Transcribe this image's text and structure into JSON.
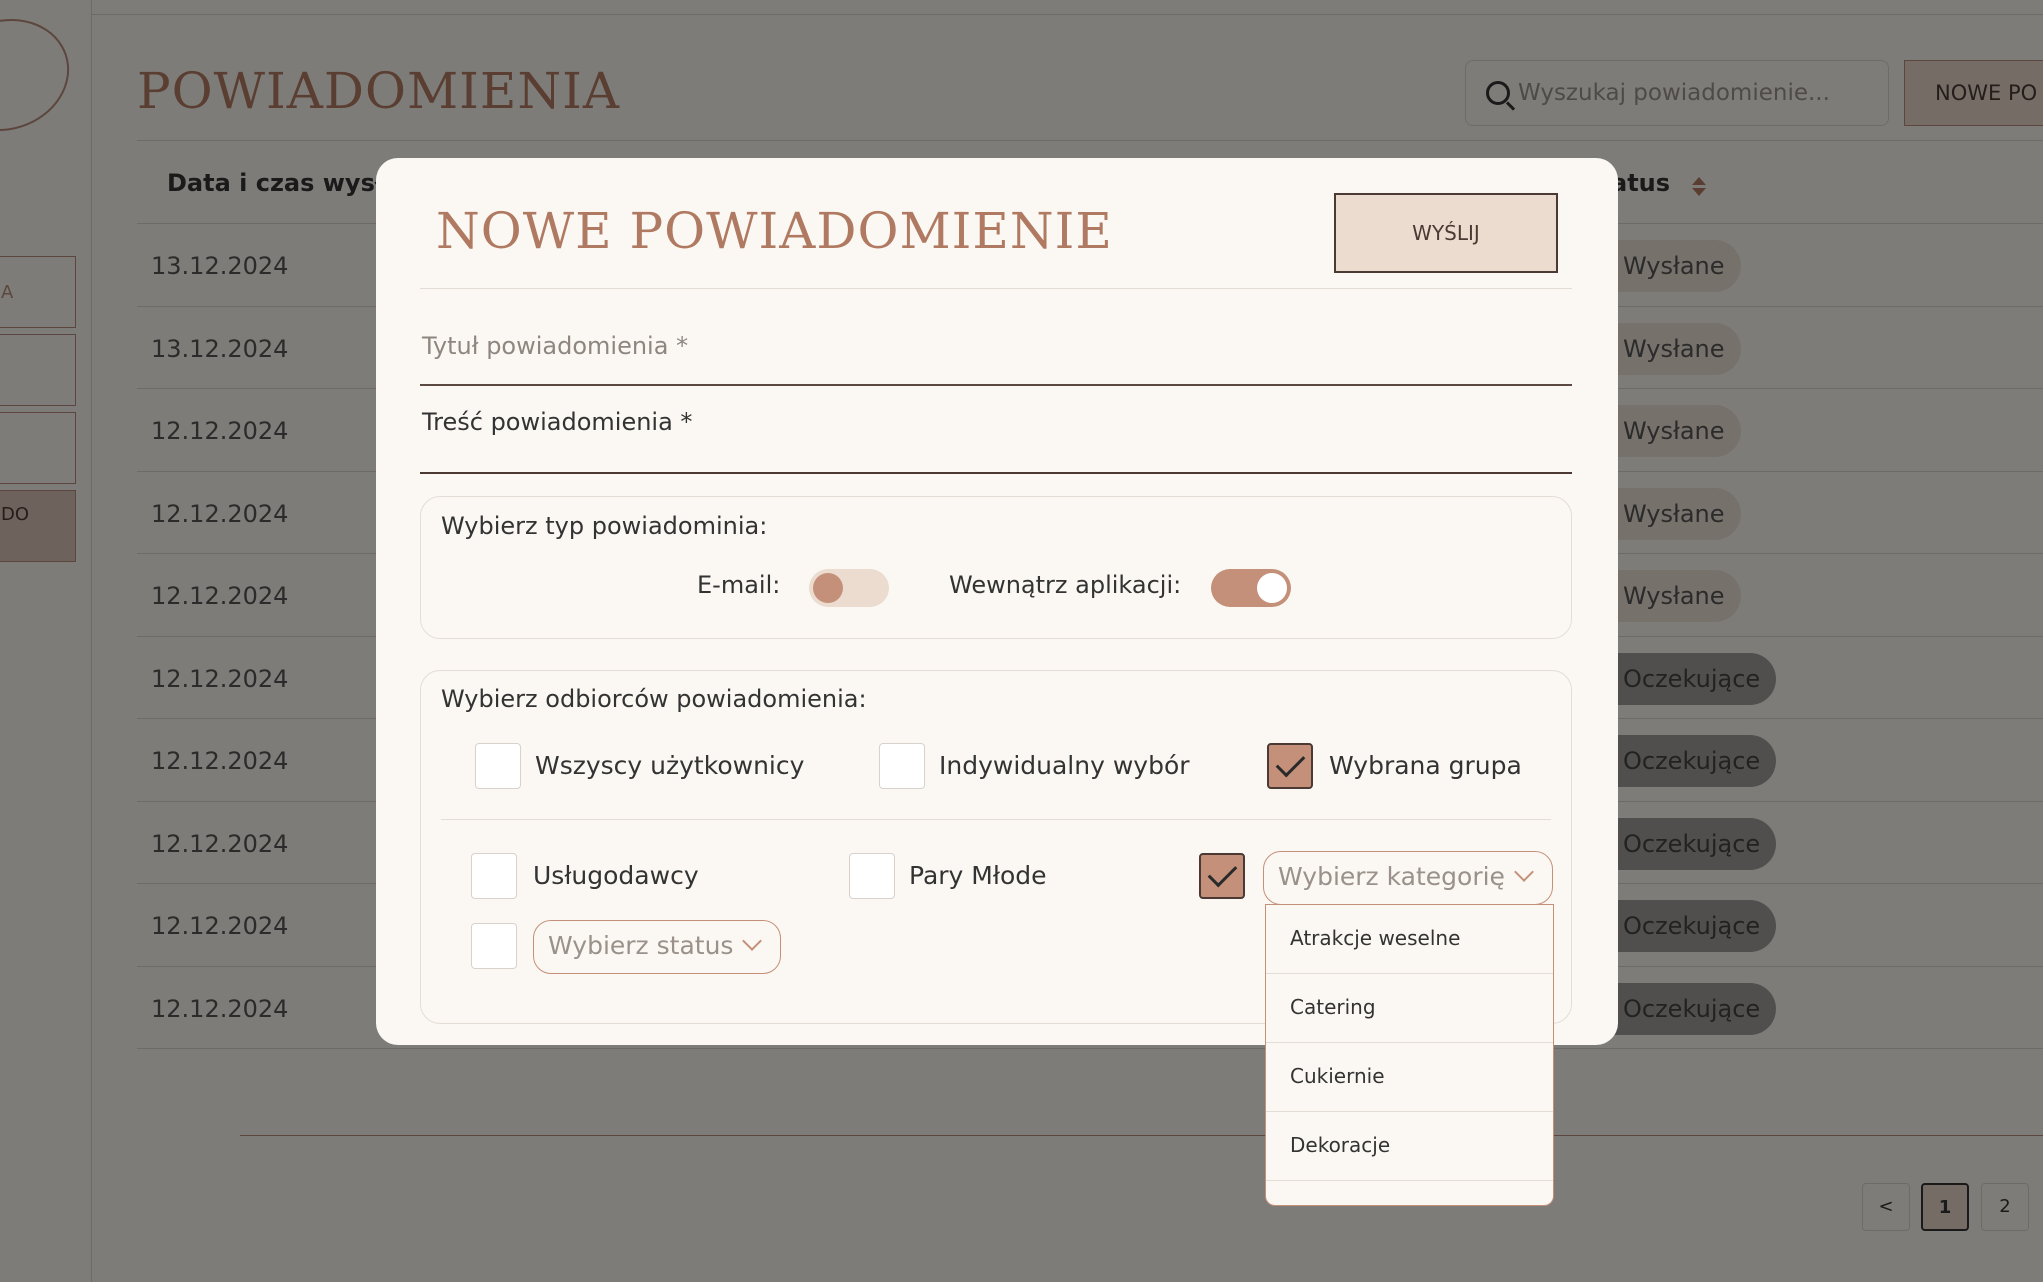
{
  "background": {
    "page_title": "POWIADOMIENIA",
    "search_placeholder": "Wyszukaj powiadomienie...",
    "new_button": "NOWE PO",
    "sidebar_labels": [
      "A",
      "",
      "",
      "DO"
    ],
    "table": {
      "col_date": "Data i czas wysła",
      "col_status": "atus",
      "rows": [
        {
          "date": "13.12.2024",
          "status": "Wysłane",
          "kind": "sent"
        },
        {
          "date": "13.12.2024",
          "status": "Wysłane",
          "kind": "sent"
        },
        {
          "date": "12.12.2024",
          "status": "Wysłane",
          "kind": "sent"
        },
        {
          "date": "12.12.2024",
          "status": "Wysłane",
          "kind": "sent"
        },
        {
          "date": "12.12.2024",
          "status": "Wysłane",
          "kind": "sent"
        },
        {
          "date": "12.12.2024",
          "status": "Oczekujące",
          "kind": "pending"
        },
        {
          "date": "12.12.2024",
          "status": "Oczekujące",
          "kind": "pending"
        },
        {
          "date": "12.12.2024",
          "status": "Oczekujące",
          "kind": "pending"
        },
        {
          "date": "12.12.2024",
          "status": "Oczekujące",
          "kind": "pending"
        },
        {
          "date": "12.12.2024",
          "status": "Oczekujące",
          "kind": "pending"
        }
      ]
    },
    "pagination": {
      "prev": "<",
      "pages": [
        "1",
        "2"
      ],
      "current": "1"
    }
  },
  "modal": {
    "title": "NOWE POWIADOMIENIE",
    "send_button": "WYŚLIJ",
    "title_field_placeholder": "Tytuł powiadomienia *",
    "body_field_label": "Treść powiadomienia *",
    "type_section": {
      "label": "Wybierz typ powiadomienia:",
      "label_as_shown": "Wybierz typ powiadominia:",
      "email_label": "E-mail:",
      "email_enabled": false,
      "inapp_label": "Wewnątrz aplikacji:",
      "inapp_enabled": true
    },
    "recipients_section": {
      "label": "Wybierz odbiorców powiadomienia:",
      "options": [
        {
          "label": "Wszyscy użytkownicy",
          "checked": false
        },
        {
          "label": "Indywidualny wybór",
          "checked": false
        },
        {
          "label": "Wybrana grupa",
          "checked": true
        }
      ],
      "groups": [
        {
          "label": "Usługodawcy",
          "checked": false
        },
        {
          "label": "Pary Młode",
          "checked": false
        }
      ],
      "category_checked": true,
      "category_select_placeholder": "Wybierz kategorię",
      "status_checked": false,
      "status_select_placeholder": "Wybierz status"
    },
    "category_dropdown": {
      "options": [
        "Atrakcje weselne",
        "Catering",
        "Cukiernie",
        "Dekoracje"
      ]
    }
  },
  "colors": {
    "accent": "#b07a62",
    "toggle_on": "#c4907a",
    "button_bg": "#ecdcd0",
    "modal_bg": "#fbf8f3"
  }
}
